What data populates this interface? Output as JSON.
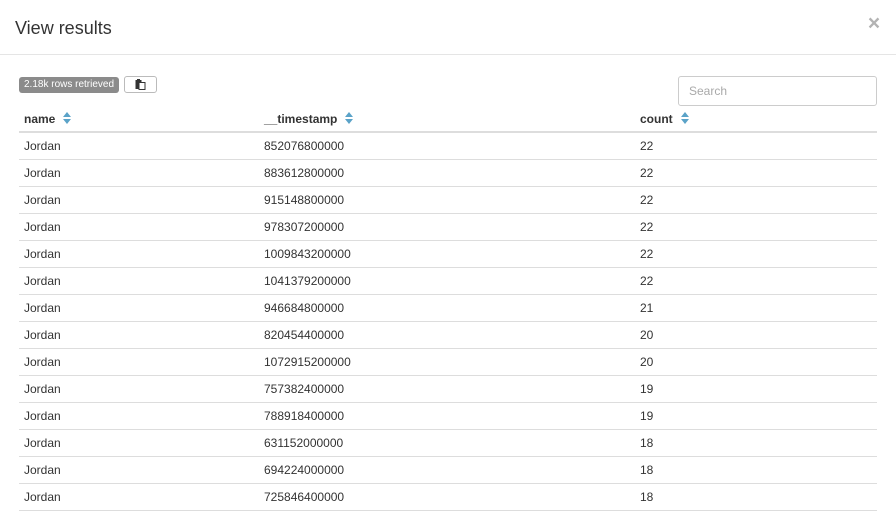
{
  "dialog": {
    "title": "View results",
    "close_label": "×"
  },
  "toolbar": {
    "rows_badge": "2.18k rows retrieved",
    "copy_icon": "clipboard-icon"
  },
  "search": {
    "placeholder": "Search",
    "value": ""
  },
  "table": {
    "columns": [
      "name",
      "__timestamp",
      "count"
    ],
    "sort_icon": "sort-icon",
    "accent_color": "#5ba3c8",
    "rows": [
      [
        "Jordan",
        "852076800000",
        "22"
      ],
      [
        "Jordan",
        "883612800000",
        "22"
      ],
      [
        "Jordan",
        "915148800000",
        "22"
      ],
      [
        "Jordan",
        "978307200000",
        "22"
      ],
      [
        "Jordan",
        "1009843200000",
        "22"
      ],
      [
        "Jordan",
        "1041379200000",
        "22"
      ],
      [
        "Jordan",
        "946684800000",
        "21"
      ],
      [
        "Jordan",
        "820454400000",
        "20"
      ],
      [
        "Jordan",
        "1072915200000",
        "20"
      ],
      [
        "Jordan",
        "757382400000",
        "19"
      ],
      [
        "Jordan",
        "788918400000",
        "19"
      ],
      [
        "Jordan",
        "631152000000",
        "18"
      ],
      [
        "Jordan",
        "694224000000",
        "18"
      ],
      [
        "Jordan",
        "725846400000",
        "18"
      ]
    ]
  }
}
